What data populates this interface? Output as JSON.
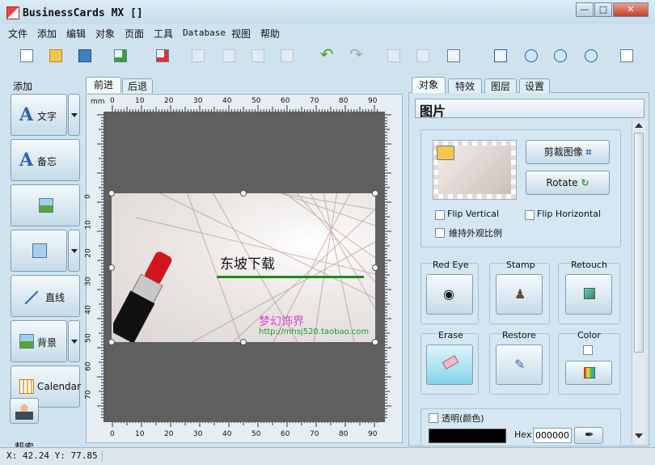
{
  "app": {
    "title": "BusinessCards MX []"
  },
  "window_buttons": {
    "minimize": "—",
    "maximize": "□",
    "close": "✕"
  },
  "menu": [
    "文件",
    "添加",
    "编辑",
    "对象",
    "页面",
    "工具",
    "Database",
    "视图",
    "帮助"
  ],
  "toolbar_icons": [
    "new-icon",
    "open-icon",
    "save-icon",
    "add-page-icon",
    "remove-page-icon",
    "group-icon",
    "ungroup-icon",
    "bring-front-icon",
    "send-back-icon",
    "undo-icon",
    "redo-icon",
    "align-icon",
    "distribute-icon",
    "layout-icon",
    "fit-icon",
    "zoom-in-icon",
    "zoom-out-icon",
    "zoom-100-icon",
    "preview-icon"
  ],
  "left_panel": {
    "header": "添加",
    "buttons": [
      {
        "label": "文字",
        "icon": "text-icon"
      },
      {
        "label": "备忘",
        "icon": "memo-icon"
      },
      {
        "label": "",
        "icon": "image-icon"
      },
      {
        "label": "",
        "icon": "rectangle-icon"
      },
      {
        "label": "直线",
        "icon": "line-icon"
      },
      {
        "label": "背景",
        "icon": "background-icon"
      },
      {
        "label": "Calendar",
        "icon": "calendar-icon"
      }
    ],
    "footer_label": "帮索"
  },
  "page_tabs": [
    "前进",
    "后退"
  ],
  "ruler": {
    "unit": "mm",
    "top_ticks": [
      "0",
      "10",
      "20",
      "30",
      "40",
      "50",
      "60",
      "70",
      "80",
      "90"
    ],
    "side_ticks": [
      "0",
      "10",
      "20",
      "30",
      "40",
      "50",
      "60",
      "70"
    ]
  },
  "card": {
    "title_text": "东坡下载",
    "subtitle_text": "梦幻饰界",
    "url_text": "http://mhsj520.taobao.com",
    "line_color": "#1a8a1a"
  },
  "right_panel": {
    "tabs": [
      "对象",
      "特效",
      "图层",
      "设置"
    ],
    "section_title": "图片",
    "crop_button": "剪裁图像",
    "rotate_button": "Rotate",
    "flip_vertical": "Flip Vertical",
    "flip_horizontal": "Flip Horizontal",
    "keep_ratio": "維持外观比例",
    "tools": [
      {
        "label": "Red Eye",
        "icon": "eye-icon"
      },
      {
        "label": "Stamp",
        "icon": "stamp-icon"
      },
      {
        "label": "Retouch",
        "icon": "retouch-icon"
      },
      {
        "label": "Erase",
        "icon": "eraser-icon"
      },
      {
        "label": "Restore",
        "icon": "restore-icon"
      },
      {
        "label": "Color",
        "icon": "color-icon"
      }
    ],
    "transparent_label": "透明(颜色)",
    "hex_label": "Hex",
    "hex_value": "000000"
  },
  "status": {
    "coords": "X: 42.24 Y: 77.85"
  }
}
